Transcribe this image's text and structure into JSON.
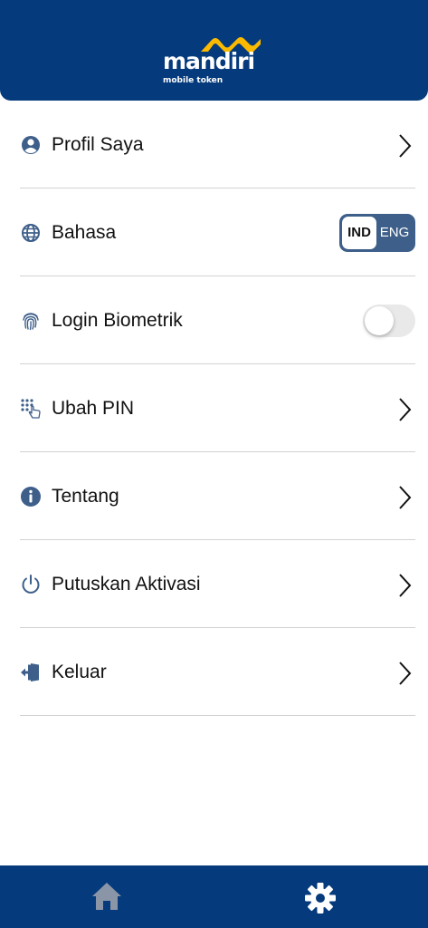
{
  "app": {
    "logo_text": "mandiri",
    "logo_subtitle": "mobile token"
  },
  "colors": {
    "brand_blue": "#053a7c",
    "brand_yellow": "#fbb900",
    "icon_blue": "#3e5f8a"
  },
  "menu": {
    "items": [
      {
        "label": "Profil Saya",
        "icon": "user-circle-icon",
        "control": "chevron"
      },
      {
        "label": "Bahasa",
        "icon": "globe-icon",
        "control": "language-toggle"
      },
      {
        "label": "Login Biometrik",
        "icon": "fingerprint-icon",
        "control": "switch",
        "enabled": false
      },
      {
        "label": "Ubah PIN",
        "icon": "pin-keypad-icon",
        "control": "chevron"
      },
      {
        "label": "Tentang",
        "icon": "info-icon",
        "control": "chevron"
      },
      {
        "label": "Putuskan Aktivasi",
        "icon": "power-icon",
        "control": "chevron"
      },
      {
        "label": "Keluar",
        "icon": "logout-door-icon",
        "control": "chevron"
      }
    ],
    "language": {
      "options": [
        "IND",
        "ENG"
      ],
      "selected": "IND"
    }
  },
  "bottom_nav": {
    "tabs": [
      {
        "icon": "home-icon",
        "active": false
      },
      {
        "icon": "gear-icon",
        "active": true
      }
    ]
  }
}
